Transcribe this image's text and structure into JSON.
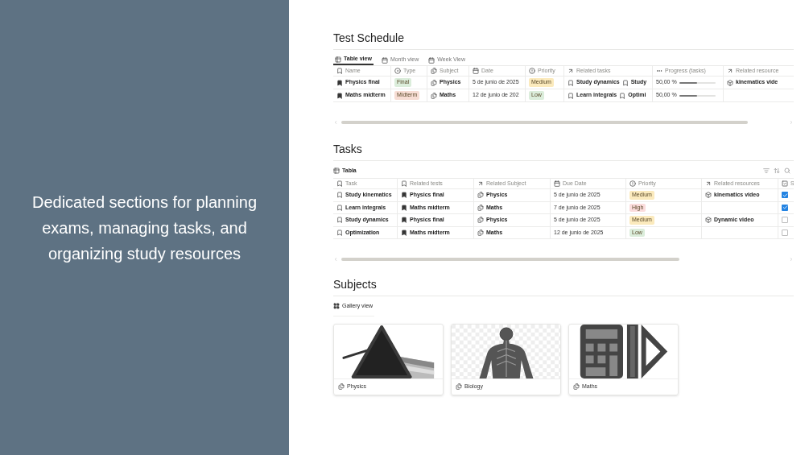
{
  "promo": {
    "text": "Dedicated sections for planning exams, managing tasks, and organizing study resources"
  },
  "test_schedule": {
    "title": "Test Schedule",
    "views": [
      {
        "label": "Table view",
        "selected": true
      },
      {
        "label": "Month view",
        "selected": false
      },
      {
        "label": "Week View",
        "selected": false
      }
    ],
    "columns": [
      "Name",
      "Type",
      "Subject",
      "Date",
      "Priority",
      "Related tasks",
      "Progress (tasks)",
      "Related resource"
    ],
    "rows": [
      {
        "name": "Physics final",
        "type": {
          "label": "Final",
          "color": "#dbeddb"
        },
        "subject": "Physics",
        "date": "5 de junio de 2025",
        "priority": {
          "label": "Medium",
          "color": "#fbeabd"
        },
        "related_tasks": [
          "Study dynamics",
          "Study"
        ],
        "progress": {
          "reading": "50,00 %",
          "level": 0.5
        },
        "related_resources": "kinematics vide"
      },
      {
        "name": "Maths midterm",
        "type": {
          "label": "Midterm",
          "color": "#f7ddd4"
        },
        "subject": "Maths",
        "date": "12 de junio de 202",
        "priority": {
          "label": "Low",
          "color": "#dbeddb"
        },
        "related_tasks": [
          "Learn integrals",
          "Optimi"
        ],
        "progress": {
          "reading": "50,00 %",
          "level": 0.5
        },
        "related_resources": ""
      }
    ]
  },
  "tasks": {
    "title": "Tasks",
    "view": "Tabla",
    "columns": [
      "Task",
      "Related tests",
      "Related Subject",
      "Due Date",
      "Priority",
      "Related resources",
      "S"
    ],
    "rows": [
      {
        "task": "Study kinematics",
        "related_test": "Physics final",
        "subject": "Physics",
        "due_date": "5 de junio de 2025",
        "priority": {
          "label": "Medium",
          "color": "#fbeabd"
        },
        "related_resources": "kinematics video",
        "checked": true
      },
      {
        "task": "Learn integrals",
        "related_test": "Maths midterm",
        "subject": "Maths",
        "due_date": "7 de junio de 2025",
        "priority": {
          "label": "High",
          "color": "#fbdcdc"
        },
        "related_resources": "",
        "checked": true
      },
      {
        "task": "Study dynamics",
        "related_test": "Physics final",
        "subject": "Physics",
        "due_date": "5 de junio de 2025",
        "priority": {
          "label": "Medium",
          "color": "#fbeabd"
        },
        "related_resources": "Dynamic video",
        "checked": false
      },
      {
        "task": "Optimization",
        "related_test": "Maths midterm",
        "subject": "Maths",
        "due_date": "12 de junio de 2025",
        "priority": {
          "label": "Low",
          "color": "#dbeddb"
        },
        "related_resources": "",
        "checked": false
      }
    ]
  },
  "subjects": {
    "title": "Subjects",
    "view": "Gallery view",
    "cards": [
      {
        "title": "Physics",
        "kind": "prism"
      },
      {
        "title": "Biology",
        "kind": "anatomy"
      },
      {
        "title": "Maths",
        "kind": "tools"
      }
    ]
  }
}
